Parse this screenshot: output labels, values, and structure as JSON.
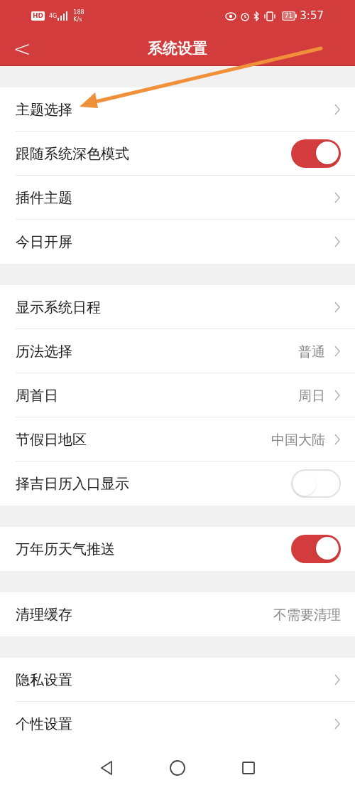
{
  "status_bar": {
    "hd": "HD",
    "network": "4G",
    "speed": "188",
    "speed_unit": "K/s",
    "battery": "71",
    "time": "3:57"
  },
  "header": {
    "back": "<",
    "title": "系统设置"
  },
  "groups": [
    {
      "rows": [
        {
          "kind": "link",
          "label": "主题选择"
        },
        {
          "kind": "toggle",
          "label": "跟随系统深色模式",
          "on": true
        },
        {
          "kind": "link",
          "label": "插件主题"
        },
        {
          "kind": "link",
          "label": "今日开屏"
        }
      ]
    },
    {
      "rows": [
        {
          "kind": "link",
          "label": "显示系统日程"
        },
        {
          "kind": "link",
          "label": "历法选择",
          "value": "普通"
        },
        {
          "kind": "link",
          "label": "周首日",
          "value": "周日"
        },
        {
          "kind": "link",
          "label": "节假日地区",
          "value": "中国大陆"
        },
        {
          "kind": "toggle",
          "label": "择吉日历入口显示",
          "on": false
        }
      ]
    },
    {
      "rows": [
        {
          "kind": "toggle",
          "label": "万年历天气推送",
          "on": true
        }
      ]
    },
    {
      "rows": [
        {
          "kind": "info",
          "label": "清理缓存",
          "value": "不需要清理"
        }
      ]
    },
    {
      "rows": [
        {
          "kind": "link",
          "label": "隐私设置"
        },
        {
          "kind": "link",
          "label": "个性设置"
        }
      ]
    }
  ]
}
